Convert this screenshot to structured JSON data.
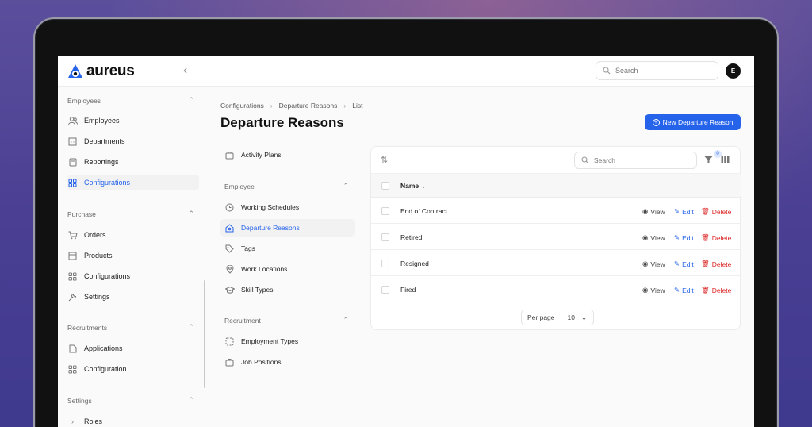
{
  "app": {
    "logo_text": "aureus"
  },
  "topbar": {
    "search_placeholder": "Search",
    "avatar_initial": "E"
  },
  "sidebar": {
    "groups": [
      {
        "title": "Employees",
        "items": [
          {
            "label": "Employees",
            "icon": "users-icon"
          },
          {
            "label": "Departments",
            "icon": "building-icon"
          },
          {
            "label": "Reportings",
            "icon": "document-icon"
          },
          {
            "label": "Configurations",
            "icon": "grid-icon",
            "active": true
          }
        ]
      },
      {
        "title": "Purchase",
        "items": [
          {
            "label": "Orders",
            "icon": "cart-icon"
          },
          {
            "label": "Products",
            "icon": "box-icon"
          },
          {
            "label": "Configurations",
            "icon": "grid-icon"
          },
          {
            "label": "Settings",
            "icon": "wrench-icon"
          }
        ]
      },
      {
        "title": "Recruitments",
        "items": [
          {
            "label": "Applications",
            "icon": "file-icon"
          },
          {
            "label": "Configuration",
            "icon": "grid-icon"
          }
        ]
      },
      {
        "title": "Settings",
        "items": [
          {
            "label": "Roles",
            "icon": "chevron-right-icon"
          }
        ]
      }
    ]
  },
  "breadcrumb": [
    "Configurations",
    "Departure Reasons",
    "List"
  ],
  "page": {
    "title": "Departure Reasons",
    "new_button": "New Departure Reason"
  },
  "subnav": {
    "top_item": "Activity Plans",
    "groups": [
      {
        "title": "Employee",
        "items": [
          "Working Schedules",
          "Departure Reasons",
          "Tags",
          "Work Locations",
          "Skill Types"
        ]
      },
      {
        "title": "Recruitment",
        "items": [
          "Employment Types",
          "Job Positions"
        ]
      }
    ]
  },
  "table": {
    "search_placeholder": "Search",
    "filter_count": "0",
    "column": "Name",
    "rows": [
      "End of Contract",
      "Retired",
      "Resigned",
      "Fired"
    ],
    "actions": {
      "view": "View",
      "edit": "Edit",
      "delete": "Delete"
    },
    "pager": {
      "label": "Per page",
      "value": "10"
    }
  },
  "colors": {
    "accent": "#2563eb",
    "danger": "#dc2626"
  }
}
